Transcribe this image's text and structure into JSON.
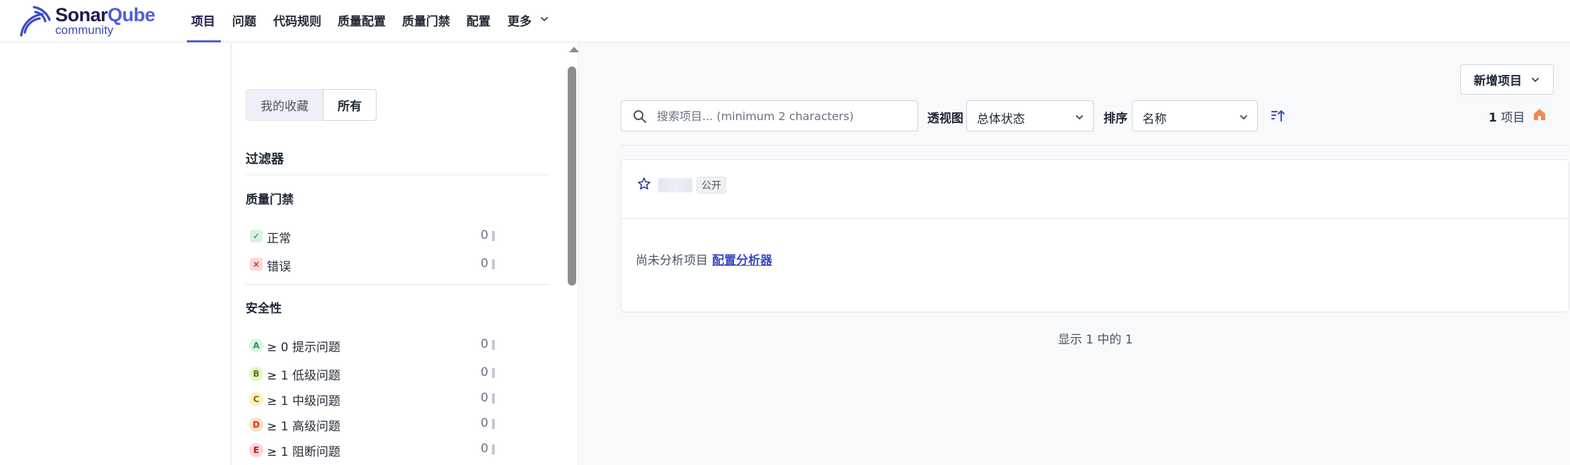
{
  "brand": {
    "name_main": "Sonar",
    "name_accent": "Qube",
    "edition": "community"
  },
  "nav": {
    "items": [
      {
        "label": "项目",
        "active": true
      },
      {
        "label": "问题"
      },
      {
        "label": "代码规则"
      },
      {
        "label": "质量配置"
      },
      {
        "label": "质量门禁"
      },
      {
        "label": "配置"
      },
      {
        "label": "更多"
      }
    ]
  },
  "sidebar": {
    "tabs": {
      "favorites": "我的收藏",
      "all": "所有"
    },
    "filters_title": "过滤器",
    "quality_gate": {
      "title": "质量门禁",
      "items": [
        {
          "label": "正常",
          "count": "0",
          "icon": "✓"
        },
        {
          "label": "错误",
          "count": "0",
          "icon": "×"
        }
      ]
    },
    "security": {
      "title": "安全性",
      "items": [
        {
          "grade": "A",
          "label": "≥ 0 提示问题",
          "count": "0",
          "color": "#16a34a",
          "bg": "#dcf5e3"
        },
        {
          "grade": "B",
          "label": "≥ 1 低级问题",
          "count": "0",
          "color": "#4d7c0f",
          "bg": "#e6f6c4"
        },
        {
          "grade": "C",
          "label": "≥ 1 中级问题",
          "count": "0",
          "color": "#a16207",
          "bg": "#fdefc0"
        },
        {
          "grade": "D",
          "label": "≥ 1 高级问题",
          "count": "0",
          "color": "#c2410c",
          "bg": "#fddcc3"
        },
        {
          "grade": "E",
          "label": "≥ 1 阻断问题",
          "count": "0",
          "color": "#b91c1c",
          "bg": "#fbd5d5"
        }
      ]
    }
  },
  "main": {
    "new_project_label": "新增项目",
    "search_placeholder": "搜索项目... (minimum 2 characters)",
    "perspective_label": "透视图",
    "perspective_value": "总体状态",
    "sort_label": "排序",
    "sort_value": "名称",
    "count_number": "1",
    "count_unit": "项目",
    "project_card": {
      "visibility_badge": "公开",
      "not_analyzed_text": "尚未分析项目",
      "configure_link": "配置分析器"
    },
    "showing_text": "显示 1 中的 1"
  },
  "colors": {
    "accent": "#4f5fd9",
    "home_icon": "#ee8b4f"
  }
}
